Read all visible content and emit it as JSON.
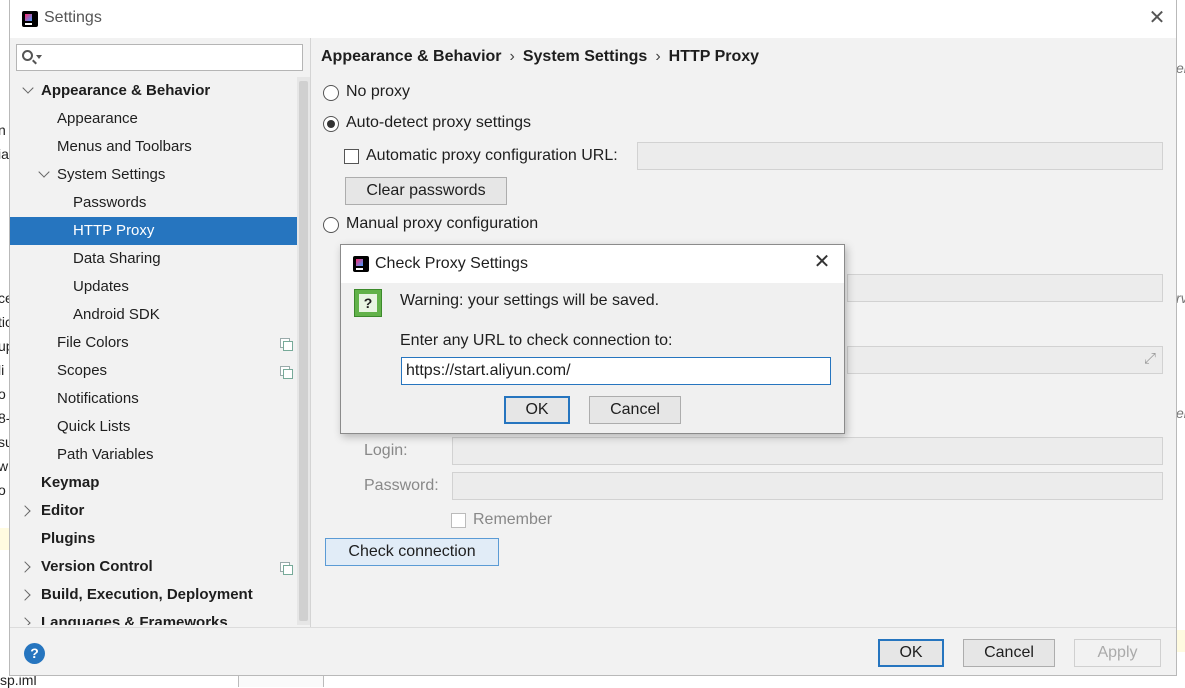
{
  "window": {
    "title": "Settings"
  },
  "tree": {
    "search_placeholder": "",
    "items": [
      {
        "label": "Appearance & Behavior",
        "bold": true,
        "expand": "down"
      },
      {
        "label": "Appearance"
      },
      {
        "label": "Menus and Toolbars"
      },
      {
        "label": "System Settings",
        "expand": "down"
      },
      {
        "label": "Passwords"
      },
      {
        "label": "HTTP Proxy",
        "selected": true
      },
      {
        "label": "Data Sharing"
      },
      {
        "label": "Updates"
      },
      {
        "label": "Android SDK"
      },
      {
        "label": "File Colors",
        "project_icon": true
      },
      {
        "label": "Scopes",
        "project_icon": true
      },
      {
        "label": "Notifications"
      },
      {
        "label": "Quick Lists"
      },
      {
        "label": "Path Variables"
      },
      {
        "label": "Keymap",
        "bold": true
      },
      {
        "label": "Editor",
        "bold": true,
        "expand": "right"
      },
      {
        "label": "Plugins",
        "bold": true
      },
      {
        "label": "Version Control",
        "bold": true,
        "expand": "right",
        "project_icon": true
      },
      {
        "label": "Build, Execution, Deployment",
        "bold": true,
        "expand": "right"
      },
      {
        "label": "Languages & Frameworks",
        "bold": true,
        "expand": "right"
      }
    ]
  },
  "breadcrumb": [
    "Appearance & Behavior",
    "System Settings",
    "HTTP Proxy"
  ],
  "proxy": {
    "no_proxy": "No proxy",
    "auto_detect": "Auto-detect proxy settings",
    "auto_config_url": "Automatic proxy configuration URL:",
    "clear_passwords": "Clear passwords",
    "manual": "Manual proxy configuration",
    "login": "Login:",
    "password": "Password:",
    "remember": "Remember",
    "check_connection": "Check connection"
  },
  "footer": {
    "ok": "OK",
    "cancel": "Cancel",
    "apply": "Apply",
    "help": "?"
  },
  "dialog": {
    "title": "Check Proxy Settings",
    "warning": "Warning: your settings will be saved.",
    "prompt": "Enter any URL to check connection to:",
    "url_value": "https://start.aliyun.com/",
    "ok": "OK",
    "cancel": "Cancel",
    "icon": "?"
  },
  "background": {
    "left_fragments": [
      "n",
      "ia",
      "ce",
      "tic",
      "up",
      "li",
      "o",
      "8-",
      "su",
      "w",
      "o"
    ],
    "right_fragments": [
      "er",
      "rv",
      "er"
    ],
    "bottom_fragment": "sp.iml"
  }
}
